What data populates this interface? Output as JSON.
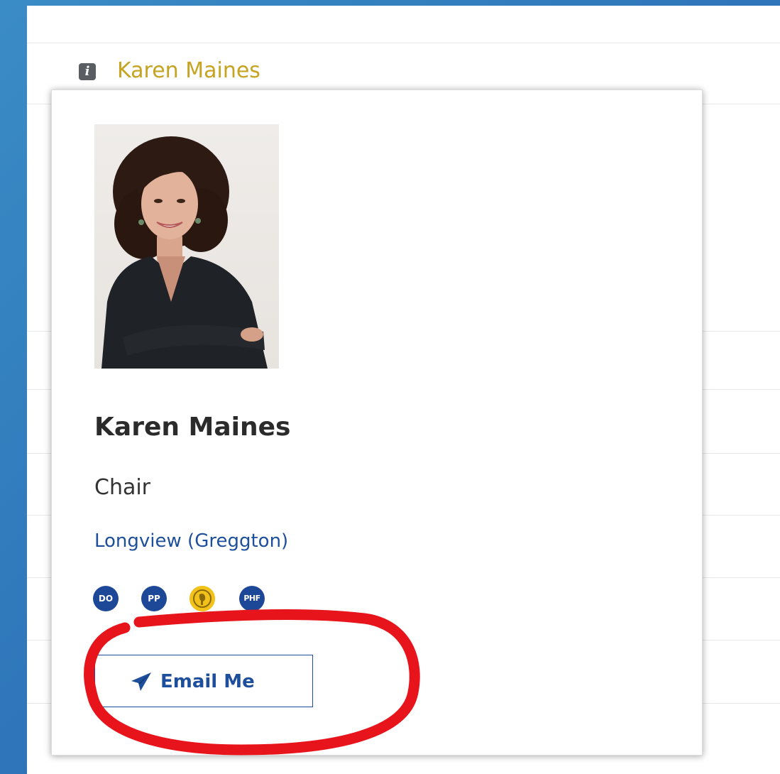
{
  "list": {
    "link_name": "Karen Maines",
    "info_icon_glyph": "i"
  },
  "popover": {
    "name": "Karen Maines",
    "role": "Chair",
    "club": "Longview (Greggton)",
    "badges": [
      {
        "label": "DO",
        "color": "#1d4797"
      },
      {
        "label": "PP",
        "color": "#1d4797"
      },
      {
        "label": "",
        "icon": "gold-medallion-icon",
        "color": "#f2c21b"
      },
      {
        "label": "PHF",
        "color": "#1d4797"
      }
    ],
    "email_button": {
      "label": "Email Me",
      "icon": "paper-plane-icon"
    }
  },
  "colors": {
    "accent_gold": "#c6a321",
    "link_blue": "#1e4f9c",
    "badge_blue": "#1d4797",
    "annotation_red": "#e8141c"
  }
}
